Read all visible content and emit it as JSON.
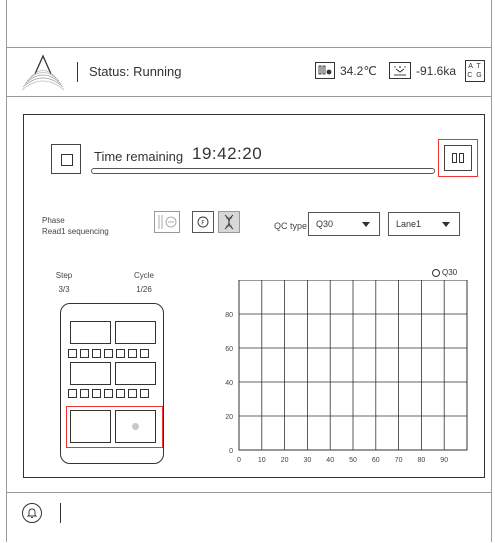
{
  "header": {
    "status": "Status: Running",
    "temperature": "34.2℃",
    "pressure": "-91.6ka",
    "bases_icon": {
      "row1": "A T",
      "row2": "C G"
    }
  },
  "run": {
    "time_remaining_label": "Time remaining",
    "time_remaining": "19:42:20",
    "progress_fraction": 0.0
  },
  "phase": {
    "label": "Phase",
    "value": "Read1 sequencing"
  },
  "qc": {
    "label": "QC type",
    "type_selected": "Q30",
    "lane_selected": "Lane1"
  },
  "flowcell": {
    "step_label": "Step",
    "step_value": "3/3",
    "cycle_label": "Cycle",
    "cycle_value": "1/26"
  },
  "chart_data": {
    "type": "line",
    "series": [
      {
        "name": "Q30",
        "values": []
      }
    ],
    "x_ticks": [
      "0",
      "10",
      "20",
      "30",
      "40",
      "50",
      "60",
      "70",
      "80",
      "90"
    ],
    "y_ticks": [
      "0",
      "20",
      "40",
      "60",
      "80"
    ],
    "xlim": [
      0,
      100
    ],
    "ylim": [
      0,
      100
    ],
    "grid": true,
    "legend": "top-right"
  },
  "colors": {
    "highlight": "#e33333",
    "line": "#333333"
  }
}
